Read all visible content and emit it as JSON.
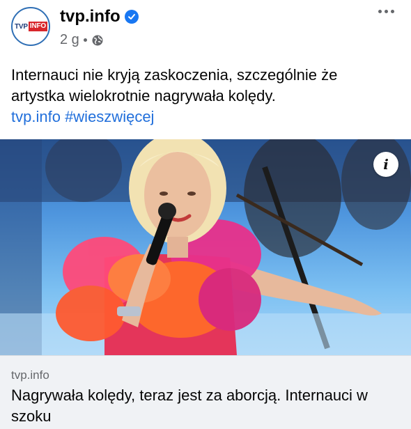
{
  "post": {
    "page_name": "tvp.info",
    "avatar_logo_left": "TVP",
    "avatar_logo_right": "INFO",
    "time": "2 g",
    "text_line1": "Internauci nie kryją zaskoczenia, szczególnie że",
    "text_line2": "artystka wielokrotnie nagrywała kolędy.",
    "link_site": "tvp.info",
    "hashtag": "#wieszwięcej"
  },
  "media": {
    "info_label": "i"
  },
  "link_card": {
    "domain": "tvp.info",
    "headline": "Nagrywała kolędy, teraz jest za aborcją. Internauci w szoku"
  },
  "colors": {
    "accent_blue": "#216fdb",
    "verified_blue": "#1877f2",
    "meta_gray": "#65676b",
    "card_bg": "#f0f2f5"
  }
}
